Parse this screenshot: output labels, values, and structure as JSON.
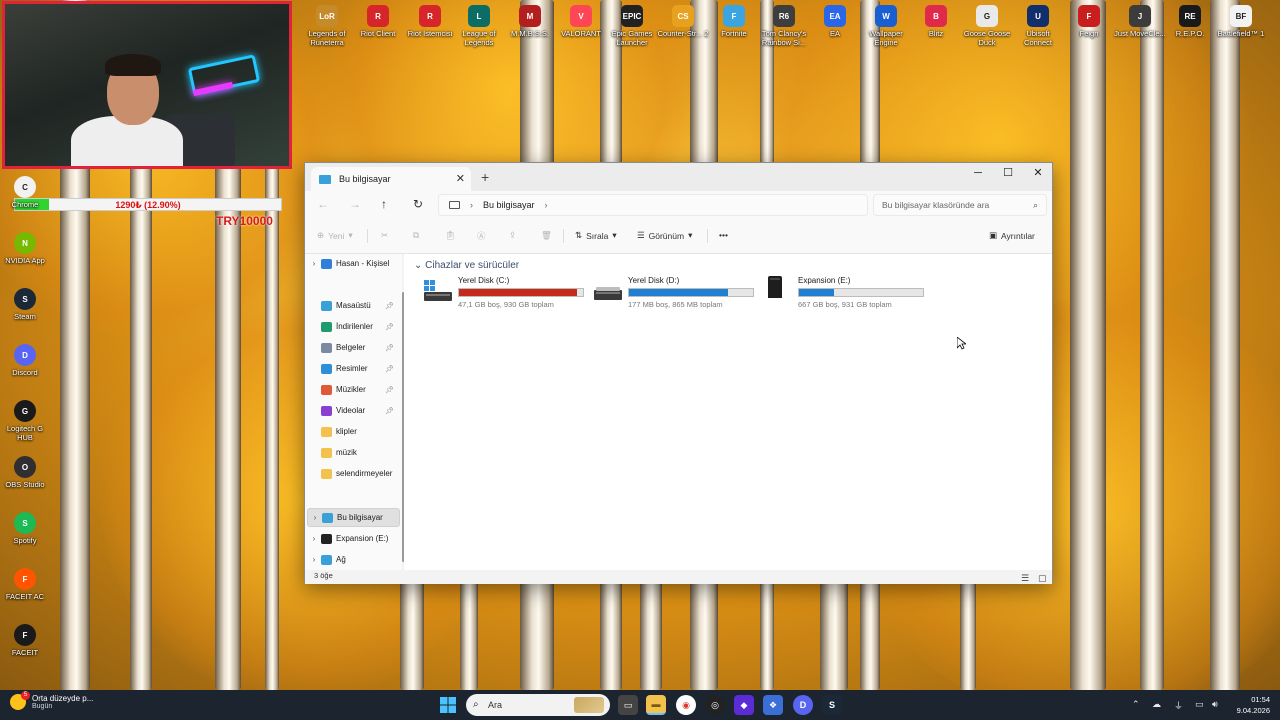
{
  "webcam": {
    "goal_progress": "1290₺ (12.90%)",
    "goal_fraction": 0.129,
    "goal_target": "TRY10000"
  },
  "desktop_icons_top": [
    {
      "label": "Legends of Runeterra",
      "color": "#c58b2b",
      "glyph": "LoR"
    },
    {
      "label": "Riot Client",
      "color": "#d6262a",
      "glyph": "R"
    },
    {
      "label": "Riot İstemcisi",
      "color": "#d6262a",
      "glyph": "R"
    },
    {
      "label": "League of Legends",
      "color": "#0b6d63",
      "glyph": "L"
    },
    {
      "label": "M.M.B.S.S.",
      "color": "#b31e1e",
      "glyph": "M"
    },
    {
      "label": "VALORANT",
      "color": "#ff4655",
      "glyph": "V"
    },
    {
      "label": "Epic Games Launcher",
      "color": "#222222",
      "glyph": "EPIC"
    },
    {
      "label": "Counter-Str... 2",
      "color": "#e8a11f",
      "glyph": "CS"
    },
    {
      "label": "Fortnite",
      "color": "#3aa5e0",
      "glyph": "F"
    },
    {
      "label": "Tom Clancy's Rainbow Si...",
      "color": "#3e3e3e",
      "glyph": "R6"
    },
    {
      "label": "EA",
      "color": "#2a66e8",
      "glyph": "EA"
    },
    {
      "label": "Wallpaper Engine",
      "color": "#1a5fd1",
      "glyph": "W"
    },
    {
      "label": "Blitz",
      "color": "#e0294b",
      "glyph": "B"
    },
    {
      "label": "Goose Goose Duck",
      "color": "#e9e9e9",
      "glyph": "G"
    },
    {
      "label": "Ubisoft Connect",
      "color": "#11306b",
      "glyph": "U"
    },
    {
      "label": "Feign",
      "color": "#c81e1e",
      "glyph": "F"
    },
    {
      "label": "Just MoveCle...",
      "color": "#3c3c3c",
      "glyph": "J"
    },
    {
      "label": "R.E.P.O.",
      "color": "#1a1a1a",
      "glyph": "RE"
    },
    {
      "label": "Battlefield™ 1",
      "color": "#f2f2f2",
      "glyph": "BF"
    }
  ],
  "desktop_icons_left": [
    {
      "label": "Chrome",
      "color": "#f2f2f2",
      "glyph": "C"
    },
    {
      "label": "NVIDIA App",
      "color": "#76b900",
      "glyph": "N"
    },
    {
      "label": "Steam",
      "color": "#1b2838",
      "glyph": "S"
    },
    {
      "label": "Discord",
      "color": "#5865f2",
      "glyph": "D"
    },
    {
      "label": "Logitech G HUB",
      "color": "#1a1a1a",
      "glyph": "G"
    },
    {
      "label": "OBS Studio",
      "color": "#302e31",
      "glyph": "O"
    },
    {
      "label": "Spotify",
      "color": "#1db954",
      "glyph": "S"
    },
    {
      "label": "FACEIT AC",
      "color": "#ff5500",
      "glyph": "F"
    },
    {
      "label": "FACEIT",
      "color": "#1a1a1a",
      "glyph": "F"
    }
  ],
  "explorer": {
    "tab_title": "Bu bilgisayar",
    "new_tab": "+",
    "window_controls": {
      "minimize": "─",
      "maximize": "☐",
      "close": "✕"
    },
    "nav": {
      "back": "←",
      "forward": "→",
      "up": "↑",
      "refresh": "↻"
    },
    "address": "Bu bilgisayar",
    "search_placeholder": "Bu bilgisayar klasöründe ara",
    "toolbar": {
      "new": "Yeni",
      "sort": "Sırala",
      "view": "Görünüm",
      "more": "•••",
      "details": "Ayrıntılar"
    },
    "sidebar": [
      {
        "label": "Hasan - Kişisel",
        "icon": "cloud-icon",
        "color": "#2f7fd9",
        "expandable": true,
        "pinned": false
      },
      {
        "label": "Masaüstü",
        "icon": "desktop-icon",
        "color": "#3aa0d8",
        "expandable": false,
        "pinned": true
      },
      {
        "label": "İndirilenler",
        "icon": "download-icon",
        "color": "#1f9b6e",
        "expandable": false,
        "pinned": true
      },
      {
        "label": "Belgeler",
        "icon": "documents-icon",
        "color": "#7a8aa0",
        "expandable": false,
        "pinned": true
      },
      {
        "label": "Resimler",
        "icon": "pictures-icon",
        "color": "#2e8fd8",
        "expandable": false,
        "pinned": true
      },
      {
        "label": "Müzikler",
        "icon": "music-icon",
        "color": "#e05a3a",
        "expandable": false,
        "pinned": true
      },
      {
        "label": "Videolar",
        "icon": "videos-icon",
        "color": "#8a3fd1",
        "expandable": false,
        "pinned": true
      },
      {
        "label": "klipler",
        "icon": "folder-icon",
        "color": "#f2c14e",
        "expandable": false,
        "pinned": false
      },
      {
        "label": "müzik",
        "icon": "folder-icon",
        "color": "#f2c14e",
        "expandable": false,
        "pinned": false
      },
      {
        "label": "selendirmeyeler",
        "icon": "folder-icon",
        "color": "#f2c14e",
        "expandable": false,
        "pinned": false
      },
      {
        "label": "Bu bilgisayar",
        "icon": "pc-icon",
        "color": "#3aa0d8",
        "expandable": true,
        "pinned": false,
        "selected": true
      },
      {
        "label": "Expansion (E:)",
        "icon": "drive-icon",
        "color": "#222222",
        "expandable": true,
        "pinned": false
      },
      {
        "label": "Ağ",
        "icon": "network-icon",
        "color": "#3aa0d8",
        "expandable": true,
        "pinned": false
      }
    ],
    "group_header": "Cihazlar ve sürücüler",
    "drives": [
      {
        "name": "Yerel Disk (C:)",
        "info": "47,1 GB boş, 930 GB toplam",
        "used_fraction": 0.95,
        "bar_color": "#c42b1c",
        "type": "system"
      },
      {
        "name": "Yerel Disk (D:)",
        "info": "177 MB boş, 865 MB toplam",
        "used_fraction": 0.8,
        "bar_color": "#1f7fd1",
        "type": "local"
      },
      {
        "name": "Expansion (E:)",
        "info": "667 GB boş, 931 GB toplam",
        "used_fraction": 0.28,
        "bar_color": "#1f7fd1",
        "type": "external"
      }
    ],
    "status": "3 öğe"
  },
  "taskbar": {
    "weather_title": "Orta düzeyde p...",
    "weather_sub": "Bugün",
    "weather_badge": "5",
    "search_label": "Ara",
    "time": "01:54",
    "date": "9.04.2026"
  }
}
